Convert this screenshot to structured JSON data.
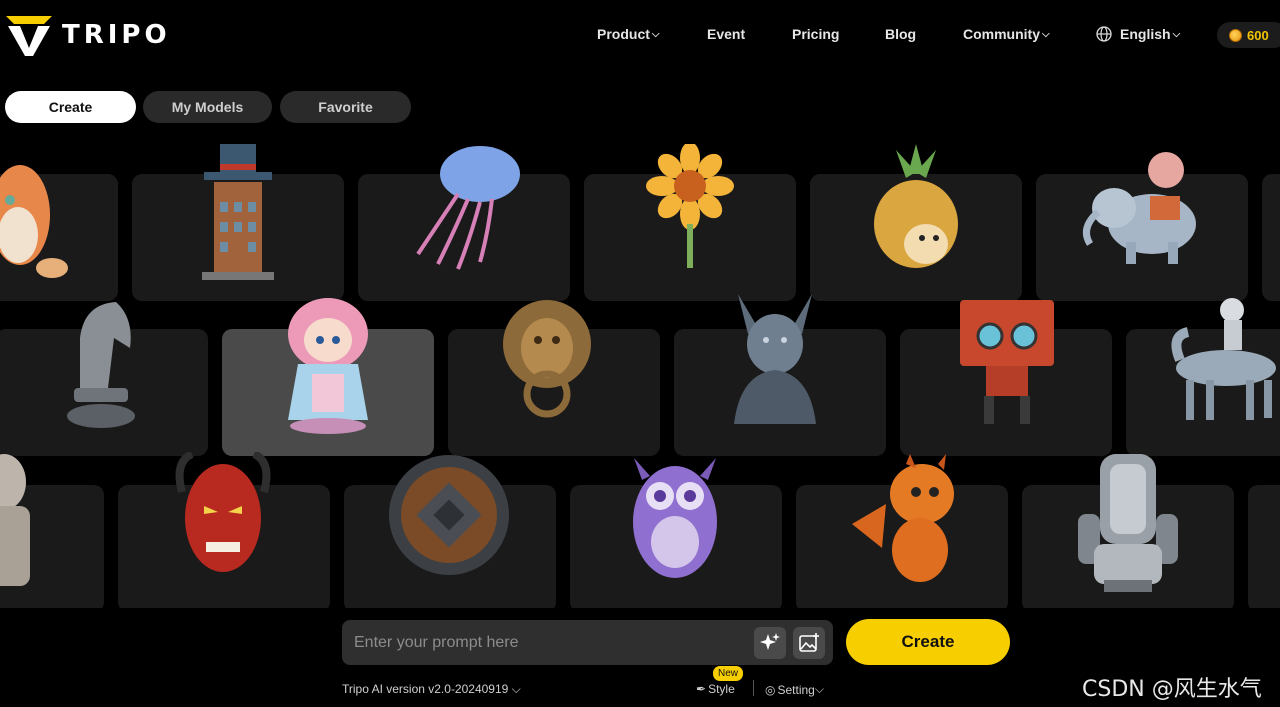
{
  "brand": {
    "name": "TRIPO"
  },
  "nav": {
    "product": "Product",
    "event": "Event",
    "pricing": "Pricing",
    "blog": "Blog",
    "community": "Community",
    "language": "English",
    "credits": "600"
  },
  "tabs": {
    "create": "Create",
    "my_models": "My Models",
    "favorite": "Favorite"
  },
  "gallery": {
    "models": [
      "cat",
      "top-hat-building",
      "jellyfish",
      "sunflower",
      "pineapple-hedgehog",
      "elephant-with-balloon",
      "chess-knight",
      "anime-girl",
      "lion-door-knocker",
      "dragon-bust",
      "red-box-robot",
      "astronaut-on-horse",
      "stone-statue",
      "oni-mask",
      "wooden-shield",
      "purple-owl",
      "orange-baby-dragon",
      "gaming-chair"
    ]
  },
  "prompt": {
    "placeholder": "Enter your prompt here"
  },
  "create_button": "Create",
  "footer": {
    "version": "Tripo AI version v2.0-20240919",
    "style": "Style",
    "new_badge": "New",
    "setting": "Setting"
  },
  "watermark": "CSDN @风生水气",
  "colors": {
    "accent": "#f7cf00",
    "background": "#000000",
    "card": "#1a1a1a"
  }
}
